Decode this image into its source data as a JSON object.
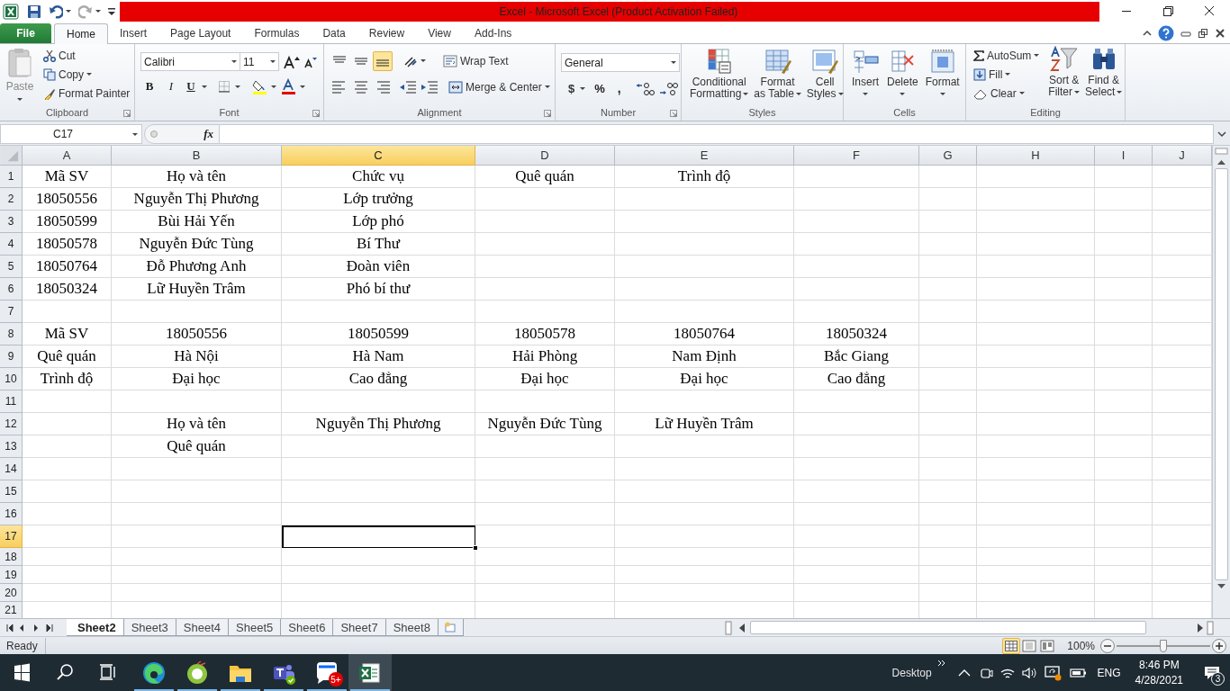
{
  "window": {
    "title": "Excel  -  Microsoft Excel (Product Activation Failed)"
  },
  "tabs": [
    {
      "label": "File",
      "kind": "file",
      "selected": false
    },
    {
      "label": "Home",
      "kind": "tab",
      "selected": true
    },
    {
      "label": "Insert",
      "kind": "tab",
      "selected": false
    },
    {
      "label": "Page Layout",
      "kind": "tab",
      "selected": false
    },
    {
      "label": "Formulas",
      "kind": "tab",
      "selected": false
    },
    {
      "label": "Data",
      "kind": "tab",
      "selected": false
    },
    {
      "label": "Review",
      "kind": "tab",
      "selected": false
    },
    {
      "label": "View",
      "kind": "tab",
      "selected": false
    },
    {
      "label": "Add-Ins",
      "kind": "tab",
      "selected": false
    }
  ],
  "ribbon": {
    "clipboard": {
      "label": "Clipboard",
      "paste": "Paste",
      "cut": "Cut",
      "copy": "Copy",
      "format_painter": "Format Painter"
    },
    "font": {
      "label": "Font",
      "family": "Calibri",
      "size": "11",
      "bold": "B",
      "italic": "I",
      "underline": "U"
    },
    "alignment": {
      "label": "Alignment",
      "vertical": [
        {
          "selected": false
        },
        {
          "selected": false
        },
        {
          "selected": true
        }
      ],
      "wrap": "Wrap Text",
      "merge": "Merge & Center"
    },
    "number": {
      "label": "Number",
      "format": "General",
      "currency": "$",
      "percent": "%",
      "comma": ","
    },
    "styles": {
      "label": "Styles",
      "buttons": [
        {
          "lines": [
            "Conditional",
            "Formatting"
          ]
        },
        {
          "lines": [
            "Format",
            "as Table"
          ]
        },
        {
          "lines": [
            "Cell",
            "Styles"
          ]
        }
      ]
    },
    "cells": {
      "label": "Cells",
      "buttons": [
        "Insert",
        "Delete",
        "Format"
      ]
    },
    "editing": {
      "label": "Editing",
      "autosum": "AutoSum",
      "fill": "Fill",
      "clear": "Clear",
      "sort": [
        "Sort &",
        "Filter"
      ],
      "find": [
        "Find &",
        "Select"
      ]
    }
  },
  "formula_bar": {
    "name_box": "C17",
    "function_label": "fx"
  },
  "columns": [
    {
      "label": "A",
      "selected": false
    },
    {
      "label": "B",
      "selected": false
    },
    {
      "label": "C",
      "selected": true
    },
    {
      "label": "D",
      "selected": false
    },
    {
      "label": "E",
      "selected": false
    },
    {
      "label": "F",
      "selected": false
    },
    {
      "label": "G",
      "selected": false
    },
    {
      "label": "H",
      "selected": false
    },
    {
      "label": "I",
      "selected": false
    },
    {
      "label": "J",
      "selected": false
    }
  ],
  "rows": [
    {
      "header": "1",
      "selected": false,
      "cells": {
        "A": "Mã SV",
        "B": "Họ và tên",
        "C": "Chức vụ",
        "D": "Quê quán",
        "E": "Trình độ"
      }
    },
    {
      "header": "2",
      "selected": false,
      "cells": {
        "A": "18050556",
        "B": "Nguyễn Thị Phương",
        "C": "Lớp trưởng"
      }
    },
    {
      "header": "3",
      "selected": false,
      "cells": {
        "A": "18050599",
        "B": "Bùi Hải Yến",
        "C": "Lớp phó"
      }
    },
    {
      "header": "4",
      "selected": false,
      "cells": {
        "A": "18050578",
        "B": "Nguyễn Đức Tùng",
        "C": "Bí Thư"
      }
    },
    {
      "header": "5",
      "selected": false,
      "cells": {
        "A": "18050764",
        "B": "Đỗ Phương Anh",
        "C": "Đoàn viên"
      }
    },
    {
      "header": "6",
      "selected": false,
      "cells": {
        "A": "18050324",
        "B": "Lữ Huyền Trâm",
        "C": "Phó bí thư"
      }
    },
    {
      "header": "7",
      "selected": false,
      "cells": {}
    },
    {
      "header": "8",
      "selected": false,
      "cells": {
        "A": "Mã SV",
        "B": "18050556",
        "C": "18050599",
        "D": "18050578",
        "E": "18050764",
        "F": "18050324"
      }
    },
    {
      "header": "9",
      "selected": false,
      "cells": {
        "A": "Quê quán",
        "B": "Hà Nội",
        "C": "Hà Nam",
        "D": "Hải Phòng",
        "E": "Nam Định",
        "F": "Bắc Giang"
      }
    },
    {
      "header": "10",
      "selected": false,
      "cells": {
        "A": "Trình độ",
        "B": "Đại học",
        "C": "Cao đẳng",
        "D": "Đại học",
        "E": "Đại học",
        "F": "Cao đẳng"
      }
    },
    {
      "header": "11",
      "selected": false,
      "cells": {}
    },
    {
      "header": "12",
      "selected": false,
      "cells": {
        "B": "Họ và tên",
        "C": "Nguyễn Thị Phương",
        "D": "Nguyễn Đức Tùng",
        "E": "Lữ Huyền Trâm"
      }
    },
    {
      "header": "13",
      "selected": false,
      "cells": {
        "B": "Quê quán"
      }
    },
    {
      "header": "14",
      "selected": false,
      "cells": {}
    },
    {
      "header": "15",
      "selected": false,
      "cells": {}
    },
    {
      "header": "16",
      "selected": false,
      "cells": {}
    },
    {
      "header": "17",
      "selected": true,
      "cells": {}
    },
    {
      "header": "18",
      "selected": false,
      "cells": {}
    },
    {
      "header": "19",
      "selected": false,
      "cells": {}
    },
    {
      "header": "20",
      "selected": false,
      "cells": {}
    },
    {
      "header": "21",
      "selected": false,
      "cells": {}
    }
  ],
  "sheets": [
    {
      "label": "Sheet2",
      "selected": true
    },
    {
      "label": "Sheet3",
      "selected": false
    },
    {
      "label": "Sheet4",
      "selected": false
    },
    {
      "label": "Sheet5",
      "selected": false
    },
    {
      "label": "Sheet6",
      "selected": false
    },
    {
      "label": "Sheet7",
      "selected": false
    },
    {
      "label": "Sheet8",
      "selected": false
    }
  ],
  "status_bar": {
    "status": "Ready",
    "zoom": "100%",
    "level": 0.5
  },
  "taskbar": {
    "zalo_badge": "5+",
    "desktop": "Desktop",
    "language": "ENG",
    "time": "8:46 PM",
    "date": "4/28/2021",
    "notifications": "3"
  }
}
